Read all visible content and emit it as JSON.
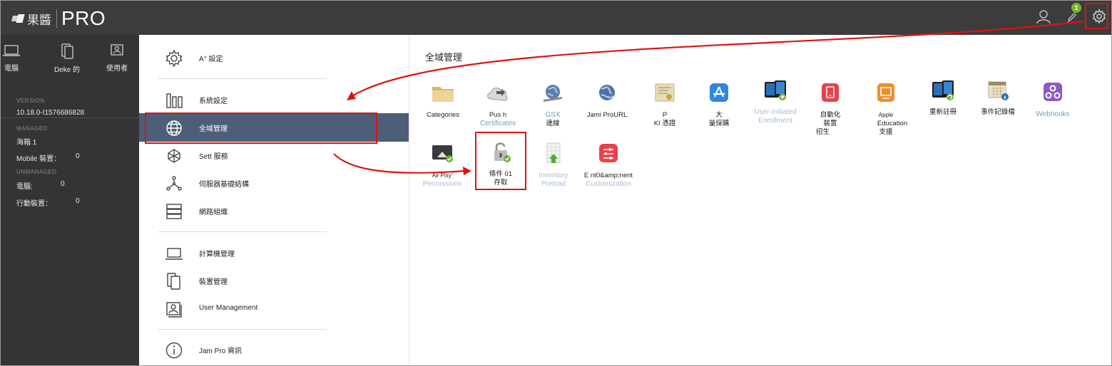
{
  "header": {
    "brand_name": "果醬",
    "brand_product": "PRO",
    "notification_count": "1",
    "icons": [
      "user-icon",
      "bell-icon",
      "gear-icon"
    ]
  },
  "left_panel": {
    "tabs": [
      {
        "label": "電腦",
        "icon": "laptop-icon"
      },
      {
        "label": "Deke 的",
        "icon": "devices-icon"
      },
      {
        "label": "使用者",
        "icon": "user-card-icon"
      }
    ],
    "version_label": "VERSION",
    "version_value": "10.18.0-t1576686828",
    "managed_label": "MANAGED",
    "managed_item": "海箱 1",
    "managed_mobile_label": "Mobile 裝置：",
    "managed_mobile_value": "0",
    "unmanaged_label": "UNMANAGED",
    "unmanaged_computers_label": "電腦:",
    "unmanaged_computers_value": "0",
    "unmanaged_mobile_label": "行動裝置：",
    "unmanaged_mobile_value": "0"
  },
  "settings_menu": {
    "items": [
      {
        "label": "A° 設定",
        "icon": "gear-icon"
      },
      {
        "label": "系統設定",
        "icon": "columns-icon"
      },
      {
        "label": "全域管理",
        "icon": "globe-icon",
        "active": true
      },
      {
        "label": "Sett 服務",
        "icon": "puzzle-icon"
      },
      {
        "label": "伺服器基礎結構",
        "icon": "network-icon"
      },
      {
        "label": "網路組織",
        "icon": "server-icon"
      },
      {
        "label": "計算機管理",
        "icon": "laptop-icon"
      },
      {
        "label": "裝置管理",
        "icon": "mobile-device-icon"
      },
      {
        "label": "User Management",
        "icon": "user-card-icon"
      },
      {
        "label": "Jam Pro 資訊",
        "icon": "info-icon"
      }
    ]
  },
  "main": {
    "title": "全域管理",
    "tiles_row1": [
      {
        "lines": [
          "Categories"
        ],
        "style": "plain",
        "icon": "folder-icon"
      },
      {
        "lines": [
          "Pus h",
          "Certificates"
        ],
        "style": "mixed",
        "icon": "cloud-push-icon"
      },
      {
        "lines": [
          "GSX",
          "連線"
        ],
        "style": "mixed",
        "icon": "globe-wrench-icon"
      },
      {
        "lines": [
          "Jami ProURL"
        ],
        "style": "plain",
        "icon": "globe-icon"
      },
      {
        "lines": [
          "P",
          "KI 憑證"
        ],
        "style": "plain",
        "icon": "certificate-icon"
      },
      {
        "lines": [
          "大",
          "量採購"
        ],
        "style": "plain",
        "icon": "app-store-icon"
      },
      {
        "lines": [
          "User-Initiated",
          "Enrollment"
        ],
        "style": "faded",
        "icon": "devices-add-icon"
      },
      {
        "lines": [
          "自動化",
          "裝置",
          "招生"
        ],
        "style": "plain",
        "icon": "device-enroll-icon"
      },
      {
        "lines": [
          "Apple",
          "Education",
          "支援"
        ],
        "style": "plain",
        "icon": "education-icon"
      },
      {
        "lines": [
          "重新註冊"
        ],
        "style": "plain",
        "icon": "re-enroll-icon"
      },
      {
        "lines": [
          "事件記錄檔"
        ],
        "style": "plain",
        "icon": "calendar-log-icon"
      },
      {
        "lines": [
          "Webhooks"
        ],
        "style": "blue",
        "icon": "webhooks-icon"
      }
    ],
    "tiles_row2": [
      {
        "lines": [
          "Air Pixy'",
          "Permissions"
        ],
        "style": "airplay",
        "icon": "airplay-icon"
      },
      {
        "lines": [
          "條件 01",
          "存取"
        ],
        "style": "plain",
        "icon": "padlock-icon"
      },
      {
        "lines": [
          "Inventory",
          "Preload"
        ],
        "style": "faded",
        "icon": "inventory-preload-icon"
      },
      {
        "lines": [
          "E nt0&amp;nent",
          "Customization"
        ],
        "style": "faded",
        "icon": "customization-icon"
      }
    ]
  },
  "colors": {
    "topbar": "#3c3c3c",
    "sidebar_dark": "#343434",
    "active_menu": "#4d5e79",
    "annotation_red": "#e01212",
    "badge_green": "#76b52b",
    "link_blue": "#7a96c2"
  }
}
